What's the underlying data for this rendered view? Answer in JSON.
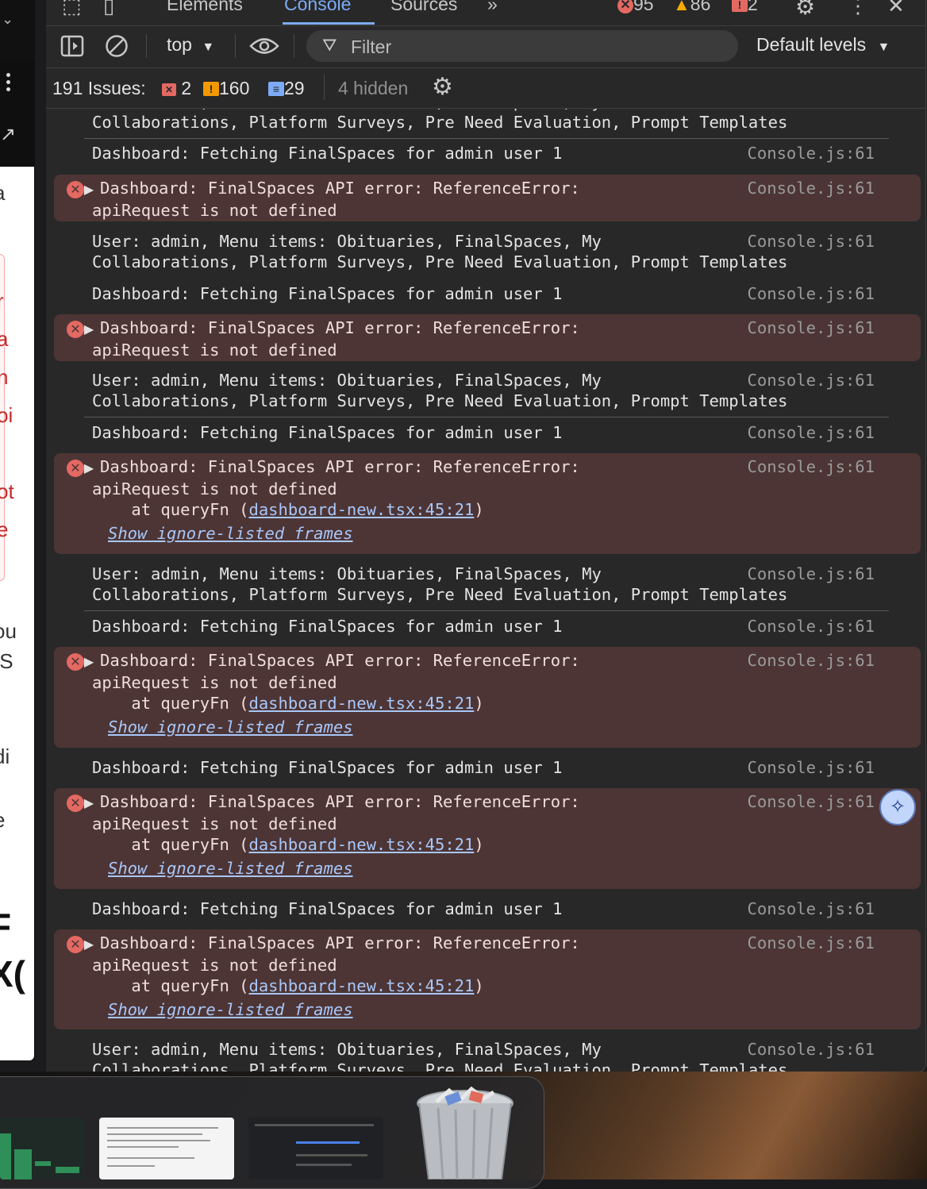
{
  "devtools": {
    "tabs": [
      "Elements",
      "Console",
      "Sources"
    ],
    "active_tab": "Console",
    "more_tabs_glyph": "»",
    "error_count": "95",
    "warning_count": "86",
    "issue_count": "2",
    "toolbar": {
      "context": "top",
      "filter_placeholder": "Filter",
      "levels": "Default levels"
    },
    "issues_bar": {
      "total": "191 Issues:",
      "errors": "2",
      "warnings": "160",
      "info": "29",
      "hidden": "4 hidden"
    }
  },
  "console": {
    "source": "Console.js:61",
    "menu_line1": "User: admin, Menu items: Obituaries, FinalSpaces, My",
    "menu_line2": "Collaborations, Platform Surveys, Pre Need Evaluation, Prompt Templates",
    "fetch_line": "Dashboard: Fetching FinalSpaces for admin user 1",
    "error_line1": "Dashboard: FinalSpaces API error: ReferenceError:",
    "error_line2": "apiRequest is not defined",
    "stack_prefix": "    at queryFn (",
    "stack_link": "dashboard-new.tsx:45:21",
    "stack_suffix": ")",
    "ignore_frames": "Show ignore-listed frames"
  },
  "left_page": {
    "fragments": [
      "a",
      "r",
      "a",
      "n",
      "oi",
      "ot",
      "e",
      "ou",
      "IS",
      "di",
      "e",
      "F",
      "X("
    ]
  },
  "icons": {
    "inspect": "inspect-element-icon",
    "device": "device-toolbar-icon",
    "settings": "gear-icon",
    "more": "kebab-menu-icon",
    "close": "close-icon",
    "sidebar": "sidebar-toggle-icon",
    "clear": "clear-console-icon",
    "live_expression": "eye-icon",
    "filter": "filter-icon",
    "ai_assist": "ai-assistance-icon",
    "trash": "trash-icon"
  },
  "colors": {
    "active_tab": "#7cacf8",
    "error_bg": "#4d3535",
    "error_icon": "#e46962",
    "warning": "#f9ab00",
    "link": "#a8c7fa"
  }
}
